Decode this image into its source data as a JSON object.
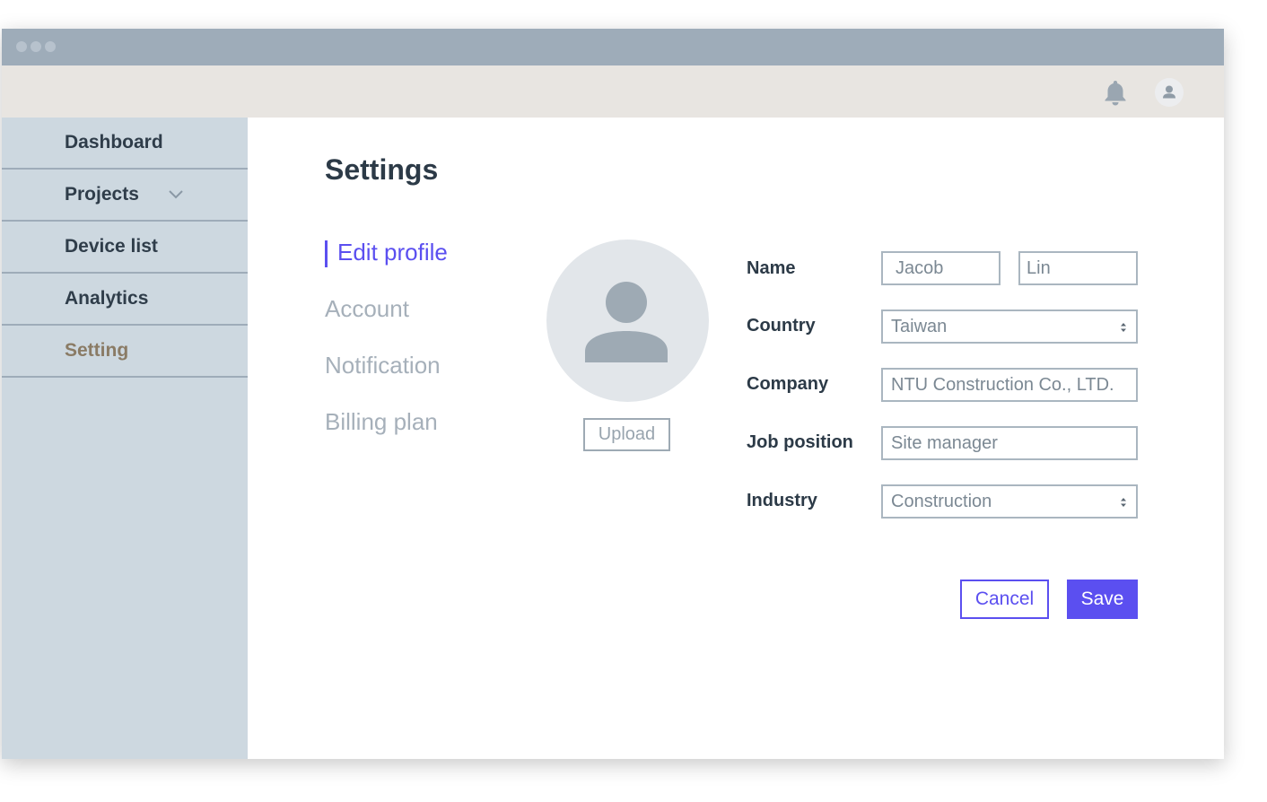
{
  "window": {
    "controls": [
      "dot",
      "dot",
      "dot"
    ]
  },
  "topbar": {
    "icons": [
      "bell-icon",
      "user-avatar-icon"
    ]
  },
  "sidebar": {
    "items": [
      {
        "label": "Dashboard",
        "active": false
      },
      {
        "label": "Projects",
        "active": false,
        "expandable": true,
        "icon": "chevron-down-icon"
      },
      {
        "label": "Device list",
        "active": false
      },
      {
        "label": "Analytics",
        "active": false
      },
      {
        "label": "Setting",
        "active": true
      }
    ]
  },
  "main": {
    "title": "Settings",
    "subnav": [
      {
        "label": "Edit profile",
        "active": true
      },
      {
        "label": "Account",
        "active": false
      },
      {
        "label": "Notification",
        "active": false
      },
      {
        "label": "Billing plan",
        "active": false
      }
    ],
    "avatar": {
      "icon": "user-placeholder-icon",
      "upload_label": "Upload"
    },
    "form": {
      "name_label": "Name",
      "first_name": "Jacob",
      "last_name": "Lin",
      "country_label": "Country",
      "country": "Taiwan",
      "company_label": "Company",
      "company": "NTU Construction Co., LTD.",
      "job_label": "Job position",
      "job": "Site manager",
      "industry_label": "Industry",
      "industry": "Construction"
    },
    "actions": {
      "cancel": "Cancel",
      "save": "Save"
    }
  },
  "colors": {
    "accent": "#5b4ff0",
    "titlebar": "#9eacb9",
    "topbar": "#e8e5e1",
    "sidebar": "#cdd8e0",
    "sidebar_active_text": "#8a7b65",
    "muted_text": "#a6b0ba"
  }
}
